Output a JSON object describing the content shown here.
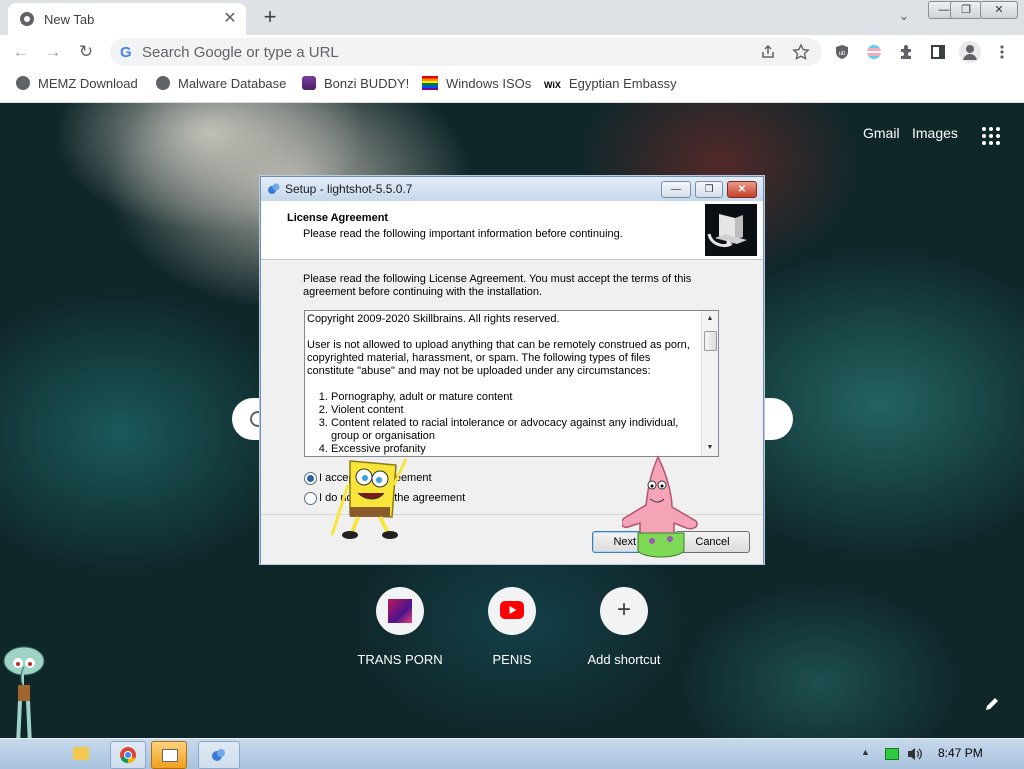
{
  "browser": {
    "tab_title": "New Tab",
    "close_glyph": "✕",
    "newtab_glyph": "+",
    "tabsearch_glyph": "⌄",
    "window_buttons": {
      "minimize": "—",
      "restore": "❐",
      "close": "✕"
    },
    "nav": {
      "back": "←",
      "forward": "→",
      "reload": "↻"
    },
    "omnibox_placeholder": "Search Google or type a URL",
    "omnibox_icon": "G",
    "toolbar_icons": [
      "share-icon",
      "star-icon",
      "ublock-icon",
      "profile-flag-icon",
      "extensions-icon",
      "sidepanel-icon",
      "avatar-icon",
      "menu-icon"
    ],
    "bookmarks": [
      {
        "label": "MEMZ Download",
        "icon": "globe-icon"
      },
      {
        "label": "Malware Database",
        "icon": "globe-icon"
      },
      {
        "label": "Bonzi BUDDY!",
        "icon": "bonzi-icon"
      },
      {
        "label": "Windows ISOs",
        "icon": "rainbow-flag-icon"
      },
      {
        "label": "Egyptian Embassy",
        "icon": "wix-icon",
        "icon_text": "WiX"
      }
    ]
  },
  "ntp": {
    "links": {
      "gmail": "Gmail",
      "images": "Images"
    },
    "shortcuts": [
      {
        "label": "TRANS PORN",
        "icon": "pink-thumbnail-icon"
      },
      {
        "label": "PENIS",
        "icon": "youtube-icon"
      },
      {
        "label": "Add shortcut",
        "icon": "plus-icon",
        "glyph": "+"
      }
    ]
  },
  "dialog": {
    "title": "Setup - lightshot-5.5.0.7",
    "heading": "License Agreement",
    "subheading": "Please read the following important information before continuing.",
    "intro": "Please read the following License Agreement. You must accept the terms of this agreement before continuing with the installation.",
    "license": {
      "copyright": "Copyright 2009-2020 Skillbrains. All rights reserved.",
      "paragraph": "User is not allowed to upload anything that can be remotely construed as porn, copyrighted material, harassment, or spam. The following types of files constitute \"abuse\" and may not be uploaded under any circumstances:",
      "items": [
        "Pornography, adult or mature content",
        "Violent content",
        "Content related to racial intolerance or advocacy against any individual, group or organisation",
        "Excessive profanity"
      ]
    },
    "radio_accept": "I accept the agreement",
    "radio_decline": "I do not accept the agreement",
    "accept_selected": true,
    "buttons": {
      "next": "Next >",
      "cancel": "Cancel"
    }
  },
  "taskbar": {
    "clock": "8:47 PM",
    "tray_arrow": "▲"
  },
  "colors": {
    "chrome_tabstrip": "#dee1e6",
    "dialog_title": "#c7d8ec",
    "taskbar": "#a9c3de",
    "youtube_red": "#ff0000"
  }
}
